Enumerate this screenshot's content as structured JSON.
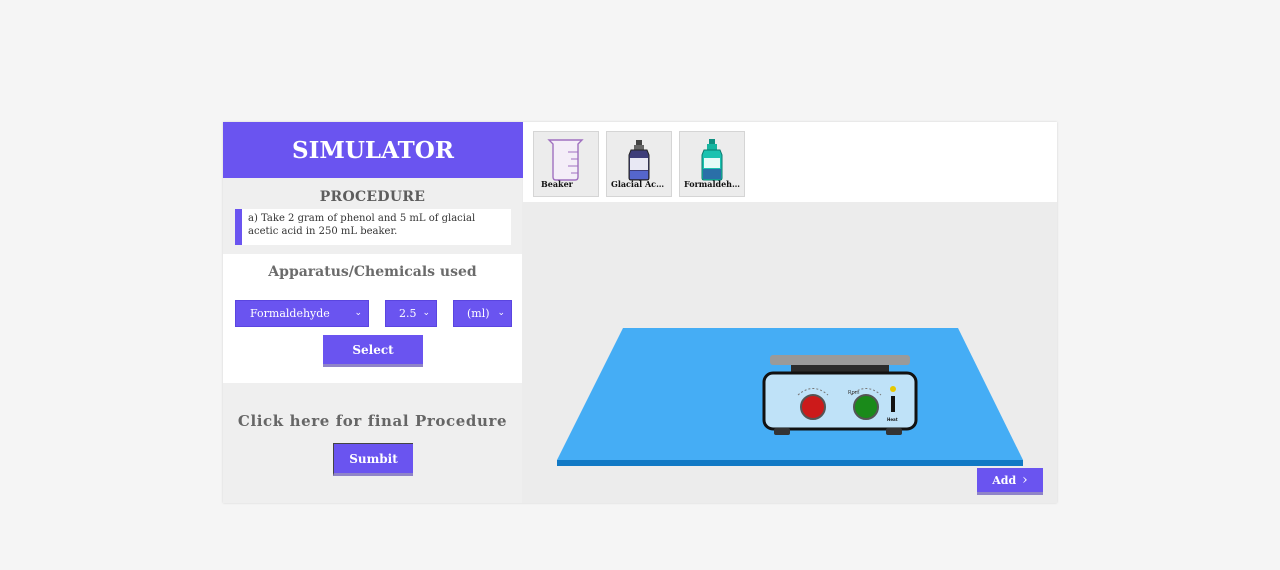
{
  "simulator": {
    "title": "SIMULATOR"
  },
  "procedure": {
    "title": "PROCEDURE",
    "step": "a) Take 2 gram of phenol and 5 mL of glacial acetic acid in 250 mL beaker."
  },
  "apparatus": {
    "title": "Apparatus/Chemicals used",
    "chemical_select": "Formaldehyde",
    "quantity_select": "2.5",
    "unit_select": "(ml)",
    "select_label": "Select"
  },
  "final": {
    "title": "Click here for final Procedure",
    "submit_label": "Sumbit"
  },
  "toolbar": {
    "items": [
      {
        "label": "Beaker",
        "icon": "beaker-icon"
      },
      {
        "label": "Glacial Acetic Acid",
        "icon": "acid-bottle-icon"
      },
      {
        "label": "Formaldehyde",
        "icon": "formaldehyde-bottle-icon"
      }
    ]
  },
  "stage": {
    "hotplate_labels": {
      "rpm": "Rpm",
      "heat": "Heat"
    },
    "add_label": "Add"
  },
  "colors": {
    "accent": "#6a54f0",
    "table": "#45adf5",
    "hotplate_knob_left": "#cc1a1a",
    "hotplate_knob_right": "#1a8a1a"
  }
}
